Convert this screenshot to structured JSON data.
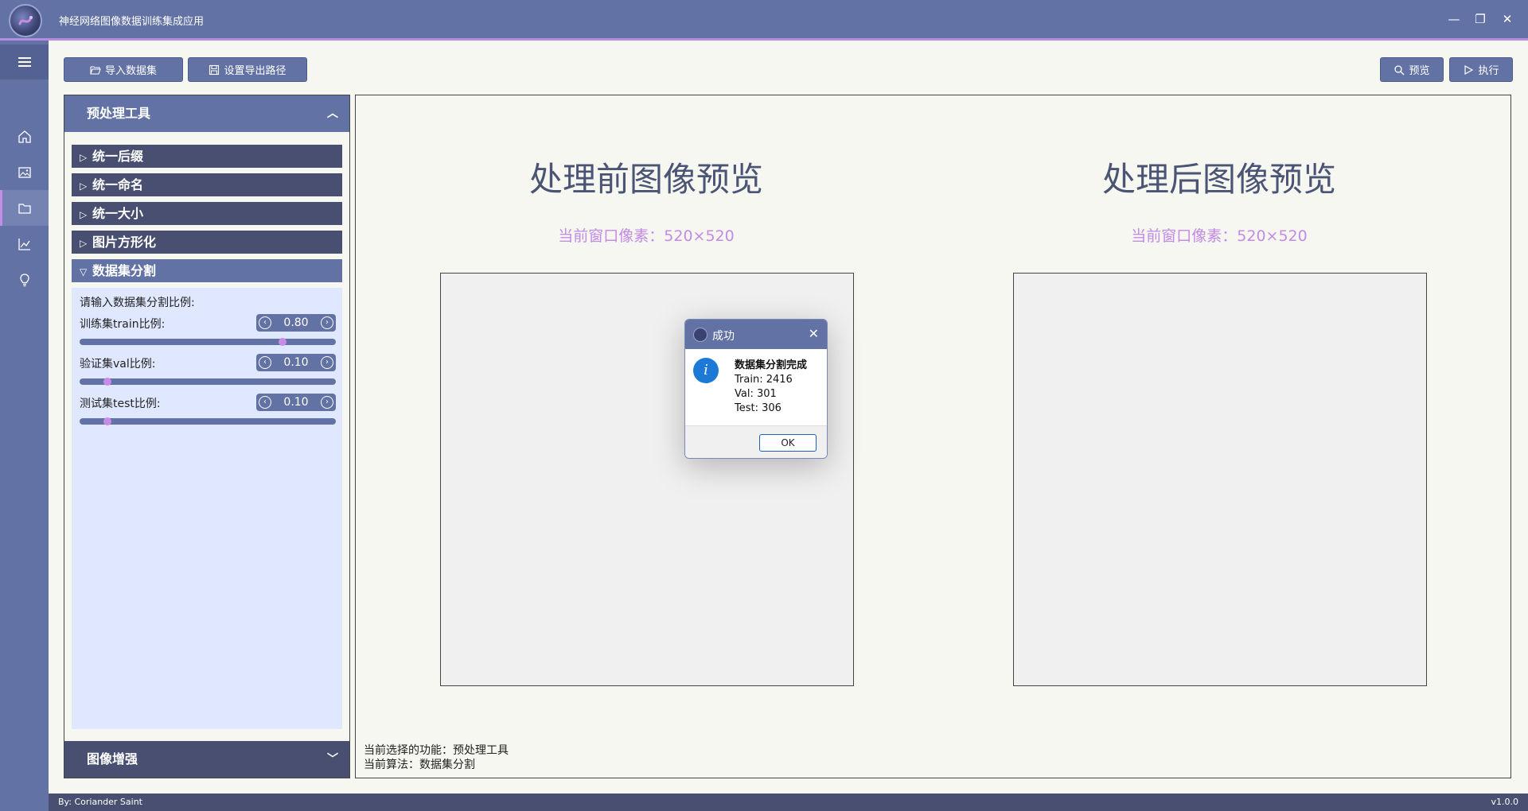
{
  "app": {
    "title": "神经网络图像数据训练集成应用"
  },
  "window_controls": {
    "minimize": "—",
    "restore": "❐",
    "close": "✕"
  },
  "nav": {
    "items": [
      "menu-icon",
      "home-icon",
      "image-icon",
      "folder-icon",
      "chart-icon",
      "bulb-icon"
    ],
    "active": "folder-icon"
  },
  "toolbar": {
    "import_label": "导入数据集",
    "export_label": "设置导出路径",
    "preview_label": "预览",
    "run_label": "执行"
  },
  "tool_panel": {
    "title": "预处理工具",
    "sections": [
      {
        "label": "统一后缀",
        "open": false
      },
      {
        "label": "统一命名",
        "open": false
      },
      {
        "label": "统一大小",
        "open": false
      },
      {
        "label": "图片方形化",
        "open": false
      },
      {
        "label": "数据集分割",
        "open": true
      }
    ],
    "split": {
      "prompt": "请输入数据集分割比例:",
      "train_label": "训练集train比例:",
      "train_value": "0.80",
      "val_label": "验证集val比例:",
      "val_value": "0.10",
      "test_label": "测试集test比例:",
      "test_value": "0.10"
    },
    "footer": "图像增强"
  },
  "preview": {
    "before_title": "处理前图像预览",
    "after_title": "处理后图像预览",
    "before_pixels": "当前窗口像素：520×520",
    "after_pixels": "当前窗口像素：520×520"
  },
  "status": {
    "function_line": "当前选择的功能：预处理工具",
    "algorithm_line": "当前算法：数据集分割"
  },
  "dialog": {
    "title": "成功",
    "line1": "数据集分割完成",
    "line2": "Train: 2416",
    "line3": "Val: 301",
    "line4": "Test: 306",
    "ok_label": "OK"
  },
  "footer": {
    "author": "By: Coriander Saint",
    "version": "v1.0.0"
  }
}
